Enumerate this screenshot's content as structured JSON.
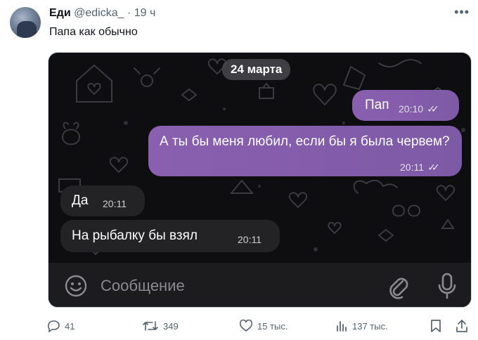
{
  "tweet": {
    "display_name": "Еди",
    "handle": "@edicka_",
    "separator": "·",
    "time_ago": "19 ч",
    "text": "Папа как обычно",
    "more_icon": "more-horizontal-icon"
  },
  "chat": {
    "date_label": "24 марта",
    "messages": [
      {
        "direction": "outgoing",
        "text": "Пап",
        "time": "20:10",
        "status": "✓✓"
      },
      {
        "direction": "outgoing",
        "text": "А ты бы меня любил, если бы я была червем?",
        "time": "20:11",
        "status": "✓✓"
      },
      {
        "direction": "incoming",
        "text": "Да",
        "time": "20:11"
      },
      {
        "direction": "incoming",
        "text": "На рыбалку бы взял",
        "time": "20:11"
      }
    ],
    "composer": {
      "placeholder": "Сообщение",
      "emoji_icon": "emoji-icon",
      "attach_icon": "paperclip-icon",
      "mic_icon": "microphone-icon"
    },
    "colors": {
      "outgoing_bubble": "#8a5fb0",
      "incoming_bubble": "#232326",
      "background": "#0e0e10"
    }
  },
  "actions": {
    "replies": "41",
    "retweets": "349",
    "likes": "15 тыс.",
    "views": "137 тыс."
  }
}
